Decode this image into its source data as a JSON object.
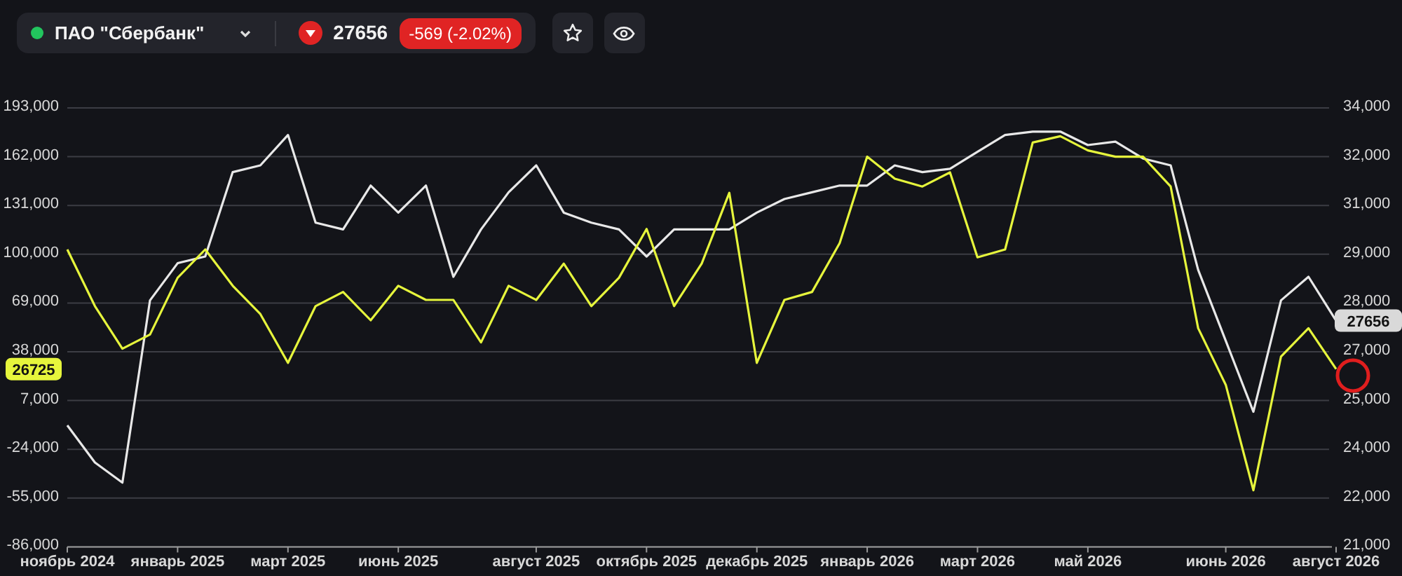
{
  "header": {
    "instrument": "ПАО \"Сбербанк\"",
    "live": true,
    "price": "27656",
    "change": "-569 (-2.02%)",
    "down": true
  },
  "chart": {
    "chart_data": {
      "type": "line",
      "categories": [
        "ноябрь 2024",
        null,
        null,
        null,
        "январь 2025",
        null,
        null,
        null,
        "март 2025",
        null,
        null,
        null,
        "июнь 2025",
        null,
        null,
        null,
        null,
        "август 2025",
        null,
        null,
        null,
        "октябрь 2025",
        null,
        null,
        null,
        "декабрь 2025",
        null,
        null,
        null,
        "январь 2026",
        null,
        null,
        null,
        "март 2026",
        null,
        null,
        null,
        "май 2026",
        null,
        null,
        null,
        null,
        "июнь 2026",
        null,
        null,
        null,
        "август 2026"
      ],
      "ylim": [
        -86000,
        193000
      ],
      "yticks": [
        {
          "value": 193000,
          "label": "193,000"
        },
        {
          "value": 162000,
          "label": "162,000"
        },
        {
          "value": 131000,
          "label": "131,000"
        },
        {
          "value": 100000,
          "label": "100,000"
        },
        {
          "value": 69000,
          "label": "69,000"
        },
        {
          "value": 38000,
          "label": "38,000"
        },
        {
          "value": 7000,
          "label": "7,000"
        },
        {
          "value": -24000,
          "label": "-24,000"
        },
        {
          "value": -55000,
          "label": "-55,000"
        },
        {
          "value": -86000,
          "label": "-86,000"
        }
      ],
      "grid": true,
      "y2lim": [
        21000,
        34000
      ],
      "y2ticks": [
        {
          "value": 34000,
          "label": "34,000"
        },
        {
          "value": 21000,
          "label": "21,000"
        }
      ],
      "series": [
        {
          "axis": "y2",
          "color": "#e8e8e8",
          "values": [
            24600,
            23500,
            22900,
            28300,
            29400,
            29600,
            32100,
            32300,
            33200,
            30600,
            30400,
            31700,
            30900,
            31700,
            29000,
            30400,
            31500,
            32300,
            30900,
            30600,
            30400,
            29600,
            30400,
            30400,
            30400,
            30900,
            31300,
            31500,
            31700,
            31700,
            32300,
            32100,
            32200,
            32700,
            33200,
            33300,
            33300,
            32900,
            33000,
            32500,
            32300,
            29200,
            27100,
            25000,
            28300,
            29000,
            27700
          ]
        },
        {
          "color": "#e6f53c",
          "values": [
            103000,
            67000,
            40000,
            49000,
            85000,
            103000,
            80000,
            62000,
            31000,
            67000,
            76000,
            58000,
            80000,
            71000,
            71000,
            44000,
            80000,
            71000,
            94000,
            67000,
            85000,
            116000,
            67000,
            94000,
            139000,
            31000,
            71000,
            76000,
            107000,
            162000,
            148000,
            143000,
            152000,
            98000,
            103000,
            171000,
            175000,
            166000,
            162000,
            162000,
            143000,
            53000,
            17000,
            -50000,
            35000,
            53000,
            27000
          ]
        }
      ],
      "annotations": [
        "27656",
        "26725"
      ]
    },
    "right_axis_labels": [
      "32,000",
      "31,000",
      "29,000",
      "28,000",
      "27,000",
      "25,000",
      "24,000",
      "22,000"
    ]
  }
}
